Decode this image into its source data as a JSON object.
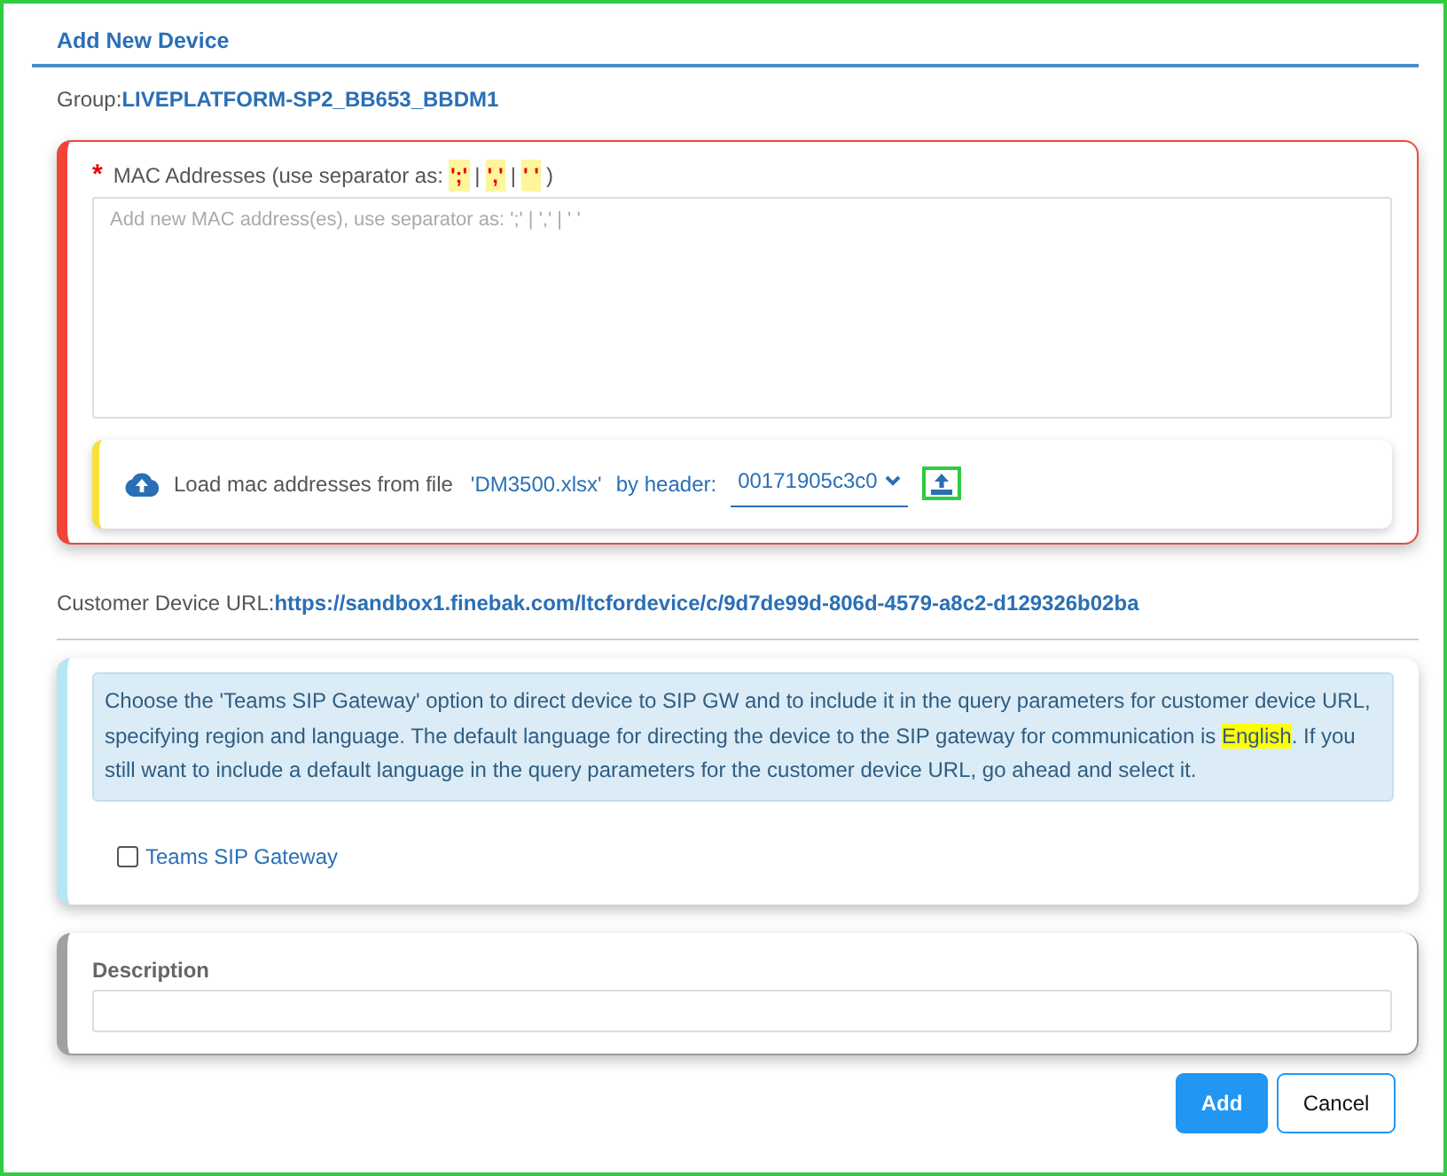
{
  "title": "Add New Device",
  "group": {
    "label": "Group:",
    "value": "LIVEPLATFORM-SP2_BB653_BBDM1"
  },
  "mac": {
    "required_mark": "*",
    "label": "MAC Addresses (use separator as:",
    "separators": [
      "';'",
      "','",
      "' '"
    ],
    "divider": "|",
    "closing": ")",
    "placeholder": "Add new MAC address(es), use separator as: ';' | ',' | ' '"
  },
  "file_loader": {
    "label": "Load mac addresses from file",
    "file_name": "'DM3500.xlsx'",
    "header_label": "by header:",
    "header_value": "00171905c3c0"
  },
  "customer_url": {
    "label": "Customer Device URL:",
    "value": "https://sandbox1.finebak.com/ltcfordevice/c/9d7de99d-806d-4579-a8c2-d129326b02ba"
  },
  "info": {
    "before": "Choose the 'Teams SIP Gateway' option to direct device to SIP GW and to include it in the query parameters for customer device URL, specifying region and language. The default language for directing the device to the SIP gateway for communication is ",
    "highlight": "English",
    "after": ". If you still want to include a default language in the query parameters for the customer device URL, go ahead and select it."
  },
  "teams_sip_gateway": {
    "label": "Teams SIP Gateway",
    "checked": false
  },
  "description": {
    "label": "Description"
  },
  "buttons": [
    {
      "label": "Add",
      "kind": "primary"
    },
    {
      "label": "Cancel",
      "kind": "secondary"
    }
  ]
}
